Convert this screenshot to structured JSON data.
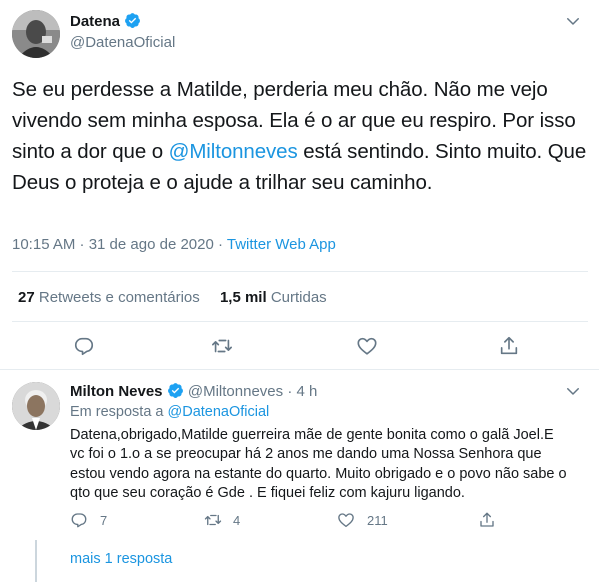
{
  "main_tweet": {
    "author_name": "Datena",
    "author_handle": "@DatenaOficial",
    "text_before_mention": "Se eu perdesse a Matilde, perderia meu chão. Não me vejo vivendo sem minha esposa. Ela é o ar que eu respiro. Por isso sinto a dor que o ",
    "mention": "@Miltonneves",
    "text_after_mention": " está sentindo. Sinto muito. Que Deus o proteja e o ajude a trilhar seu caminho.",
    "timestamp": "10:15 AM · 31 de ago de 2020",
    "separator": " · ",
    "source": "Twitter Web App",
    "retweets_count": "27",
    "retweets_label": "Retweets e comentários",
    "likes_count": "1,5 mil",
    "likes_label": "Curtidas"
  },
  "reply": {
    "author_name": "Milton Neves",
    "author_handle": "@Miltonneves",
    "time_ago": "· 4 h",
    "replying_to_label": "Em resposta a ",
    "replying_to_handle": "@DatenaOficial",
    "text": "Datena,obrigado,Matilde guerreira mãe de gente bonita como o galã Joel.E vc foi o 1.o a se preocupar há 2 anos me dando uma Nossa Senhora que estou vendo agora na estante do quarto. Muito obrigado e o povo não sabe o qto que seu coração é Gde . E fiquei feliz com kajuru ligando.",
    "reply_count": "7",
    "retweet_count": "4",
    "like_count": "211"
  },
  "more_replies": "mais 1 resposta",
  "colors": {
    "accent": "#1da1f2",
    "link": "#1b95e0",
    "muted": "#657786",
    "text": "#14171a",
    "divider": "#e6ecf0"
  },
  "icons": [
    "verified-badge-icon",
    "chevron-down-icon",
    "reply-icon",
    "retweet-icon",
    "like-icon",
    "share-icon"
  ]
}
